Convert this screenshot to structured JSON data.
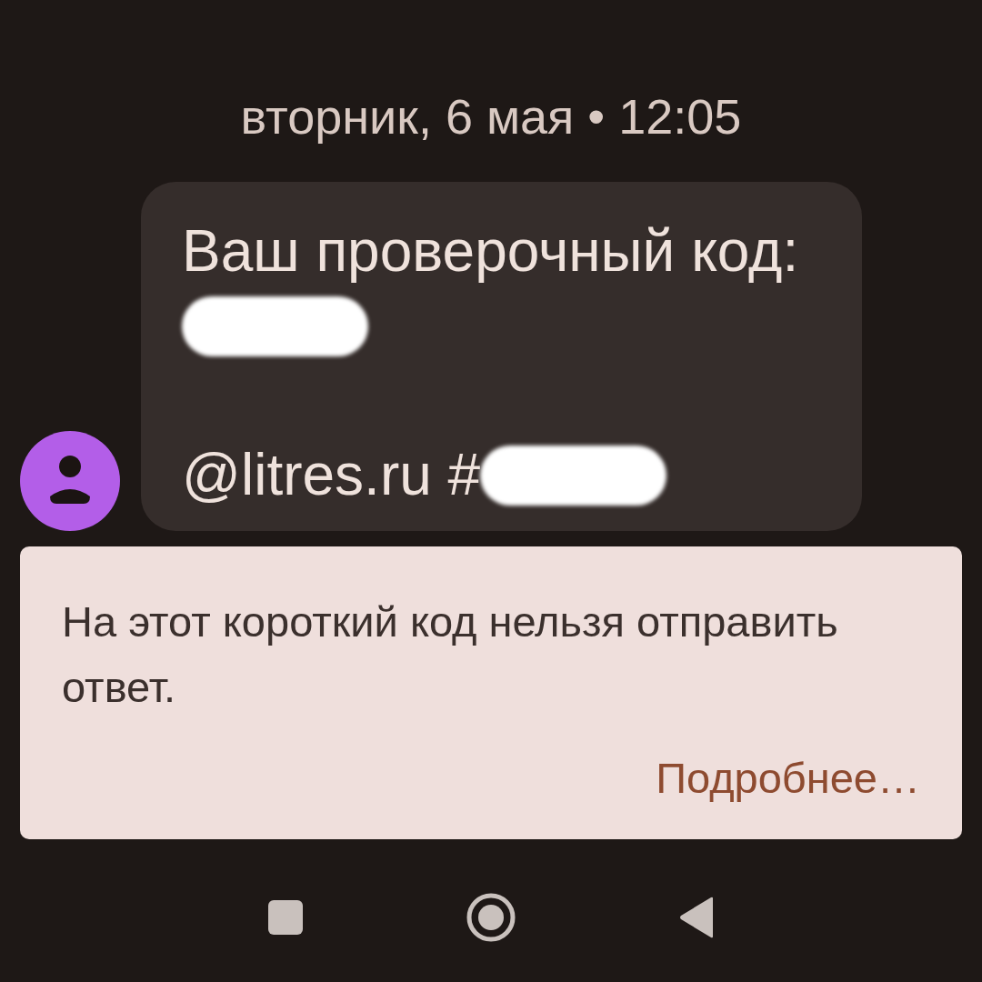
{
  "timestamp": "вторник, 6 мая • 12:05",
  "message": {
    "paragraphs": [
      {
        "text": "Ваш проверочный код:",
        "redacted": true
      },
      {
        "text": "@litres.ru #",
        "redacted": true
      }
    ]
  },
  "notice": {
    "text": "На этот короткий код нельзя отправить ответ.",
    "link": "Подробнее…"
  },
  "nav_bar": [
    {
      "kind": "recents"
    },
    {
      "kind": "home"
    },
    {
      "kind": "back"
    }
  ]
}
